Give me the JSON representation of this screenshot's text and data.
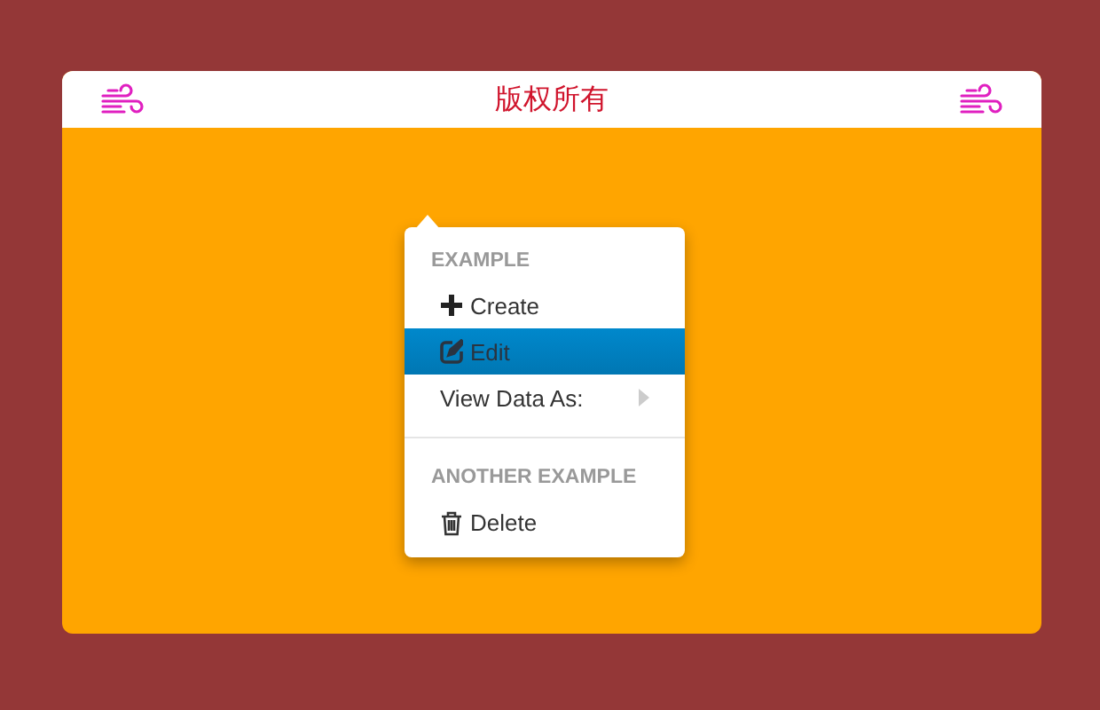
{
  "header": {
    "title": "版权所有"
  },
  "context_menu": {
    "items": [
      {
        "kind": "header",
        "label": "EXAMPLE"
      },
      {
        "kind": "plus",
        "label": "Create",
        "selected": false
      },
      {
        "kind": "edit",
        "label": "Edit",
        "selected": true
      },
      {
        "kind": "submenu",
        "label": "View Data As:",
        "selected": false
      },
      {
        "kind": "divider"
      },
      {
        "kind": "header",
        "label": "ANOTHER EXAMPLE"
      },
      {
        "kind": "trash",
        "label": "Delete",
        "selected": false
      }
    ]
  }
}
